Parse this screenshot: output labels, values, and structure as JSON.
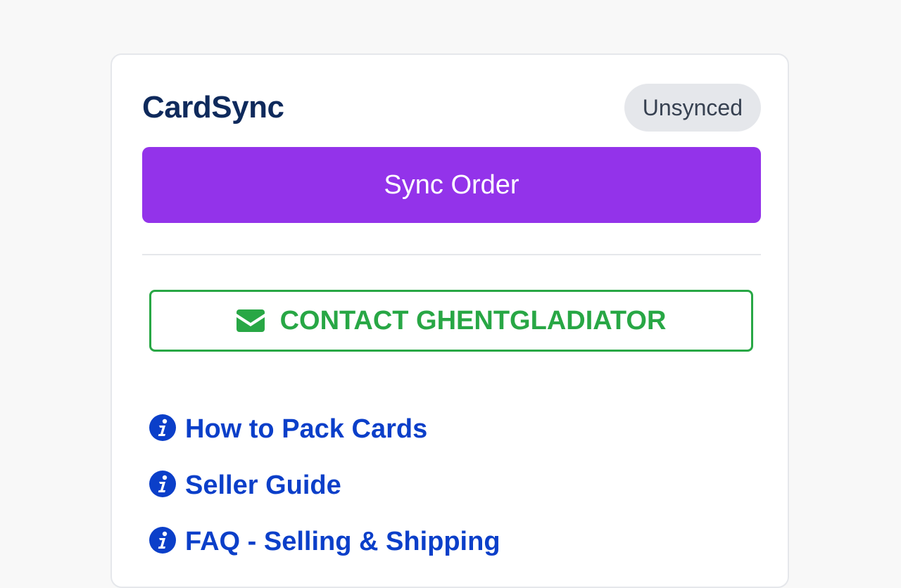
{
  "app": {
    "title": "CardSync",
    "status": "Unsynced"
  },
  "actions": {
    "sync_label": "Sync Order",
    "contact_label": "CONTACT GHENTGLADIATOR",
    "contact_icon": "envelope-icon"
  },
  "links": [
    {
      "label": "How to Pack Cards",
      "icon": "info-icon"
    },
    {
      "label": "Seller Guide",
      "icon": "info-icon"
    },
    {
      "label": "FAQ - Selling & Shipping",
      "icon": "info-icon"
    }
  ],
  "colors": {
    "accent": "#9333ea",
    "contact": "#28a745",
    "link": "#0b3fc9",
    "title": "#0f2a5c",
    "badge_bg": "#e5e7eb"
  }
}
